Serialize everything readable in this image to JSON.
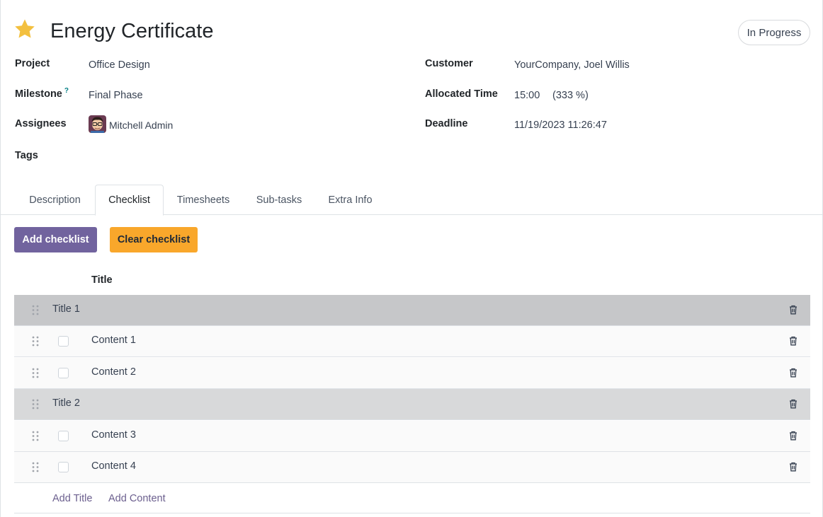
{
  "header": {
    "title": "Energy Certificate",
    "status": "In Progress",
    "starred": true,
    "colors": {
      "star": "#f3c03f"
    }
  },
  "fields": {
    "project": {
      "label": "Project",
      "value": "Office Design"
    },
    "milestone": {
      "label": "Milestone",
      "help": "?",
      "value": "Final Phase"
    },
    "assignees": {
      "label": "Assignees",
      "value": "Mitchell Admin",
      "icon": "avatar"
    },
    "tags": {
      "label": "Tags"
    },
    "customer": {
      "label": "Customer",
      "value": "YourCompany, Joel Willis"
    },
    "allocated_time": {
      "label": "Allocated Time",
      "value": "15:00",
      "percent": "(333 %)"
    },
    "deadline": {
      "label": "Deadline",
      "value": "11/19/2023 11:26:47"
    }
  },
  "tabs": [
    {
      "label": "Description"
    },
    {
      "label": "Checklist",
      "active": true
    },
    {
      "label": "Timesheets"
    },
    {
      "label": "Sub-tasks"
    },
    {
      "label": "Extra Info"
    }
  ],
  "toolbar": {
    "add_label": "Add checklist",
    "clear_label": "Clear checklist",
    "colors": {
      "primary": "#71639e",
      "warning": "#f9a72b"
    }
  },
  "checklist": {
    "column_title": "Title",
    "rows": [
      {
        "type": "section",
        "text": "Title 1"
      },
      {
        "type": "item",
        "text": "Content 1",
        "checked": false
      },
      {
        "type": "item",
        "text": "Content 2",
        "checked": false
      },
      {
        "type": "section",
        "text": "Title 2"
      },
      {
        "type": "item",
        "text": "Content 3",
        "checked": false
      },
      {
        "type": "item",
        "text": "Content 4",
        "checked": false
      }
    ],
    "add_title_label": "Add Title",
    "add_content_label": "Add Content",
    "row_icons": {
      "handle": "drag-handle-icon",
      "delete": "trash-icon"
    }
  }
}
